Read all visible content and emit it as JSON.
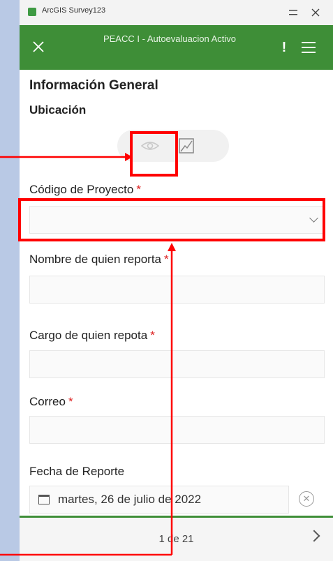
{
  "window": {
    "app_title": "ArcGIS Survey123",
    "menu_icon": "minimize-icon",
    "close_icon": "close-icon"
  },
  "toolbar": {
    "title": "PEACC I - Autoevaluacion Activo",
    "close_icon": "close-icon",
    "alert_icon": "exclamation-icon",
    "menu_icon": "hamburger-menu-icon"
  },
  "form": {
    "section_title": "Información General",
    "location_label": "Ubicación",
    "location_toggle": {
      "view_icon": "eye-icon",
      "edit_icon": "draw-icon"
    },
    "fields": [
      {
        "label": "Código de Proyecto",
        "required_mark": "*",
        "value": ""
      },
      {
        "label": "Nombre de quien reporta",
        "required_mark": "*",
        "value": ""
      },
      {
        "label": "Cargo de quien repota",
        "required_mark": "*",
        "value": ""
      },
      {
        "label": "Correo",
        "required_mark": "*",
        "value": ""
      }
    ],
    "date_label": "Fecha de Reporte",
    "date_value": "martes, 26 de julio de 2022"
  },
  "footer": {
    "page_indicator": "1 de 21"
  },
  "annotations": {
    "color": "#ff0000"
  }
}
